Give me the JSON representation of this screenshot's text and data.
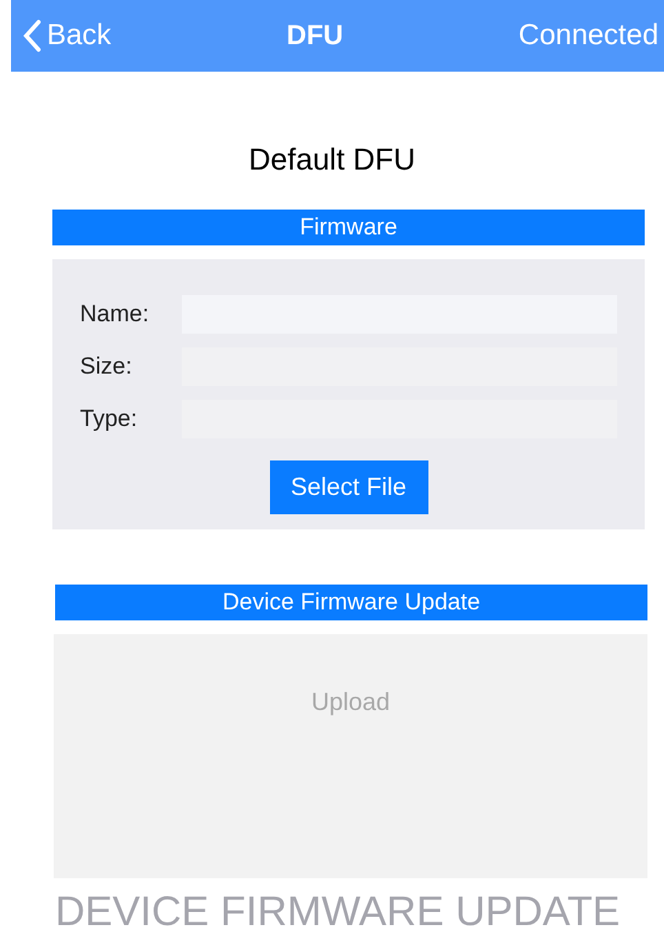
{
  "nav_bar": {
    "back": "Back",
    "title": "DFU",
    "status": "Connected"
  },
  "page_title": "Default DFU",
  "firmware": {
    "header": "Firmware",
    "fields": [
      {
        "label": "Name:"
      },
      {
        "label": "Size:"
      },
      {
        "label": "Type:"
      }
    ],
    "select_button": "Select File"
  },
  "update": {
    "header": "Device Firmware Update",
    "upload_button": {
      "label": "Upload",
      "disabled": true
    }
  },
  "caption": "DEVICE FIRMWARE UPDATE"
}
